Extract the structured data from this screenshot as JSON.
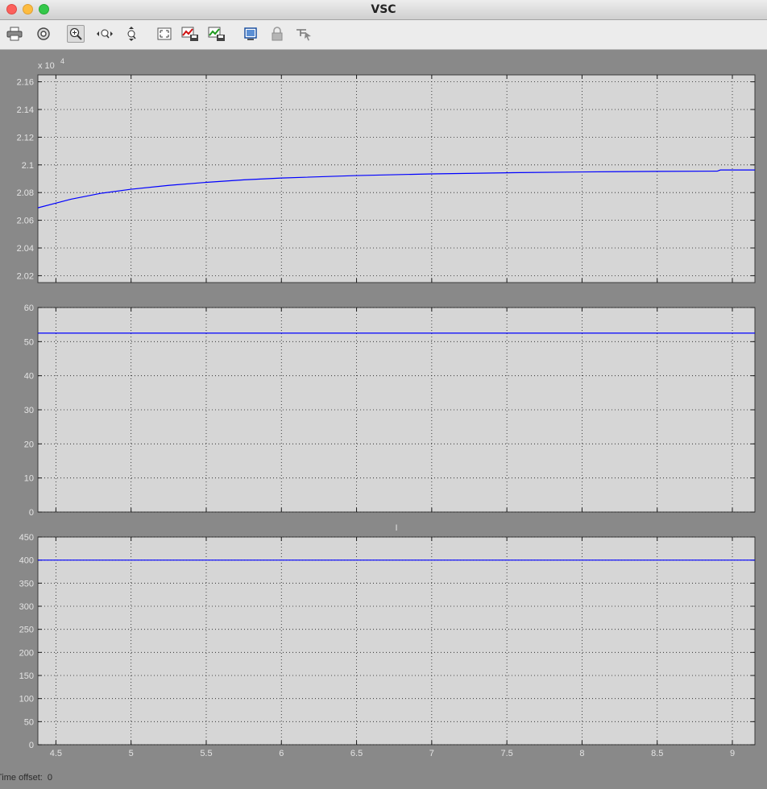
{
  "window": {
    "title": "VSC"
  },
  "toolbar": {
    "icons": [
      "printer-icon",
      "parameters-icon",
      "zoom-in-icon",
      "zoom-x-icon",
      "zoom-y-icon",
      "autoscale-icon",
      "save-axes-icon",
      "restore-axes-icon",
      "floating-scope-icon",
      "lock-axes-icon",
      "signal-selection-icon"
    ],
    "active_icon": "zoom-in-icon"
  },
  "status": {
    "time_offset_label": "Time offset:",
    "time_offset_value": "0"
  },
  "colors": {
    "plot_background": "#d6d6d6",
    "frame_background": "#898989",
    "line": "#0000ff"
  },
  "chart_data": [
    {
      "type": "line",
      "title": "",
      "xlabel": "",
      "ylabel": "",
      "exponent_label": "x 10",
      "exponent_power": "4",
      "xlim": [
        4.38,
        9.15
      ],
      "ylim": [
        2.015,
        2.165
      ],
      "grid": true,
      "xticks": [
        4.5,
        5,
        5.5,
        6,
        6.5,
        7,
        7.5,
        8,
        8.5,
        9
      ],
      "xticklabels": [],
      "yticks": [
        2.02,
        2.04,
        2.06,
        2.08,
        2.1,
        2.12,
        2.14,
        2.16
      ],
      "yticklabels": [
        "2.02",
        "2.04",
        "2.06",
        "2.08",
        "2.1",
        "2.12",
        "2.14",
        "2.16"
      ],
      "series": [
        {
          "x": [
            4.38,
            4.6,
            4.8,
            5.0,
            5.25,
            5.5,
            5.75,
            6.0,
            6.5,
            7.0,
            7.5,
            8.0,
            8.5,
            8.9,
            8.92,
            9.15
          ],
          "y": [
            2.069,
            2.0752,
            2.0795,
            2.0824,
            2.0852,
            2.0874,
            2.0892,
            2.0905,
            2.0923,
            2.0935,
            2.0943,
            2.0949,
            2.0953,
            2.0955,
            2.0963,
            2.0963
          ]
        }
      ]
    },
    {
      "type": "line",
      "title": "",
      "xlabel": "",
      "ylabel": "",
      "xlim": [
        4.38,
        9.15
      ],
      "ylim": [
        0,
        60
      ],
      "grid": true,
      "xticks": [
        4.5,
        5,
        5.5,
        6,
        6.5,
        7,
        7.5,
        8,
        8.5,
        9
      ],
      "xticklabels": [],
      "yticks": [
        0,
        10,
        20,
        30,
        40,
        50,
        60
      ],
      "yticklabels": [
        "0",
        "10",
        "20",
        "30",
        "40",
        "50",
        "60"
      ],
      "series": [
        {
          "x": [
            4.38,
            9.15
          ],
          "y": [
            52.5,
            52.5
          ]
        }
      ]
    },
    {
      "type": "line",
      "title": "I",
      "xlabel": "",
      "ylabel": "",
      "xlim": [
        4.38,
        9.15
      ],
      "ylim": [
        0,
        450
      ],
      "grid": true,
      "xticks": [
        4.5,
        5,
        5.5,
        6,
        6.5,
        7,
        7.5,
        8,
        8.5,
        9
      ],
      "xticklabels": [
        "4.5",
        "5",
        "5.5",
        "6",
        "6.5",
        "7",
        "7.5",
        "8",
        "8.5",
        "9"
      ],
      "yticks": [
        0,
        50,
        100,
        150,
        200,
        250,
        300,
        350,
        400,
        450
      ],
      "yticklabels": [
        "0",
        "50",
        "100",
        "150",
        "200",
        "250",
        "300",
        "350",
        "400",
        "450"
      ],
      "series": [
        {
          "x": [
            4.38,
            9.15
          ],
          "y": [
            400,
            400
          ]
        }
      ]
    }
  ]
}
